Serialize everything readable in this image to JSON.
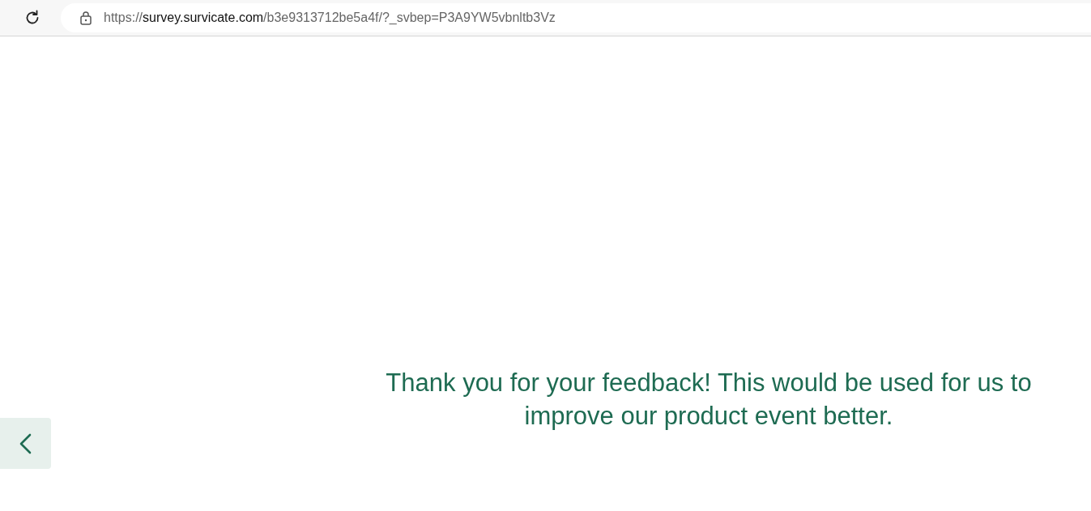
{
  "browser": {
    "url_scheme": "https://",
    "url_host": "survey.survicate.com",
    "url_path": "/b3e9313712be5a4f/?_svbep=P3A9YW5vbnltb3Vz"
  },
  "page": {
    "message": "Thank you for your feedback! This would be used for us to improve our product event better."
  }
}
